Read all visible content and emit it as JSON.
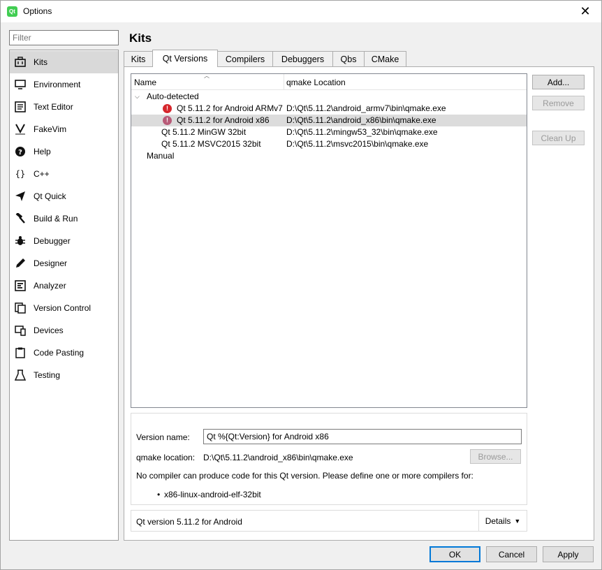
{
  "window": {
    "title": "Options",
    "app_icon": "Qt"
  },
  "filter": {
    "placeholder": "Filter"
  },
  "sidebar": {
    "items": [
      {
        "label": "Kits",
        "icon": "kits-icon"
      },
      {
        "label": "Environment",
        "icon": "monitor-icon"
      },
      {
        "label": "Text Editor",
        "icon": "text-editor-icon"
      },
      {
        "label": "FakeVim",
        "icon": "fakevim-icon"
      },
      {
        "label": "Help",
        "icon": "help-icon"
      },
      {
        "label": "C++",
        "icon": "braces-icon"
      },
      {
        "label": "Qt Quick",
        "icon": "paper-plane-icon"
      },
      {
        "label": "Build & Run",
        "icon": "hammer-icon"
      },
      {
        "label": "Debugger",
        "icon": "bug-icon"
      },
      {
        "label": "Designer",
        "icon": "pencil-icon"
      },
      {
        "label": "Analyzer",
        "icon": "analyzer-icon"
      },
      {
        "label": "Version Control",
        "icon": "version-control-icon"
      },
      {
        "label": "Devices",
        "icon": "devices-icon"
      },
      {
        "label": "Code Pasting",
        "icon": "clipboard-icon"
      },
      {
        "label": "Testing",
        "icon": "flask-icon"
      }
    ],
    "selected": "Kits"
  },
  "page": {
    "title": "Kits"
  },
  "tabs": [
    "Kits",
    "Qt Versions",
    "Compilers",
    "Debuggers",
    "Qbs",
    "CMake"
  ],
  "active_tab": "Qt Versions",
  "tree": {
    "headers": {
      "name": "Name",
      "location": "qmake Location"
    },
    "groups": [
      {
        "label": "Auto-detected",
        "expanded": true
      },
      {
        "label": "Manual"
      }
    ],
    "rows": [
      {
        "name": "Qt 5.11.2 for Android ARMv7",
        "location": "D:\\Qt\\5.11.2\\android_armv7\\bin\\qmake.exe",
        "error": true
      },
      {
        "name": "Qt 5.11.2 for Android x86",
        "location": "D:\\Qt\\5.11.2\\android_x86\\bin\\qmake.exe",
        "error": true,
        "selected": true
      },
      {
        "name": "Qt 5.11.2 MinGW 32bit",
        "location": "D:\\Qt\\5.11.2\\mingw53_32\\bin\\qmake.exe",
        "error": false
      },
      {
        "name": "Qt 5.11.2 MSVC2015 32bit",
        "location": "D:\\Qt\\5.11.2\\msvc2015\\bin\\qmake.exe",
        "error": false
      }
    ]
  },
  "side_buttons": {
    "add": "Add...",
    "remove": "Remove",
    "cleanup": "Clean Up"
  },
  "details": {
    "version_name_label": "Version name:",
    "version_name_value": "Qt %{Qt:Version} for Android x86",
    "qmake_label": "qmake location:",
    "qmake_value": "D:\\Qt\\5.11.2\\android_x86\\bin\\qmake.exe",
    "browse": "Browse...",
    "warning": "No compiler can produce code for this Qt version. Please define one or more compilers for:",
    "abi_bullet": "•",
    "abi": "x86-linux-android-elf-32bit"
  },
  "summary": {
    "text": "Qt version 5.11.2 for Android",
    "details_button": "Details"
  },
  "footer": {
    "ok": "OK",
    "cancel": "Cancel",
    "apply": "Apply"
  },
  "colors": {
    "accent": "#0078d7",
    "error": "#d6272d",
    "selection": "#dcdcdc"
  }
}
